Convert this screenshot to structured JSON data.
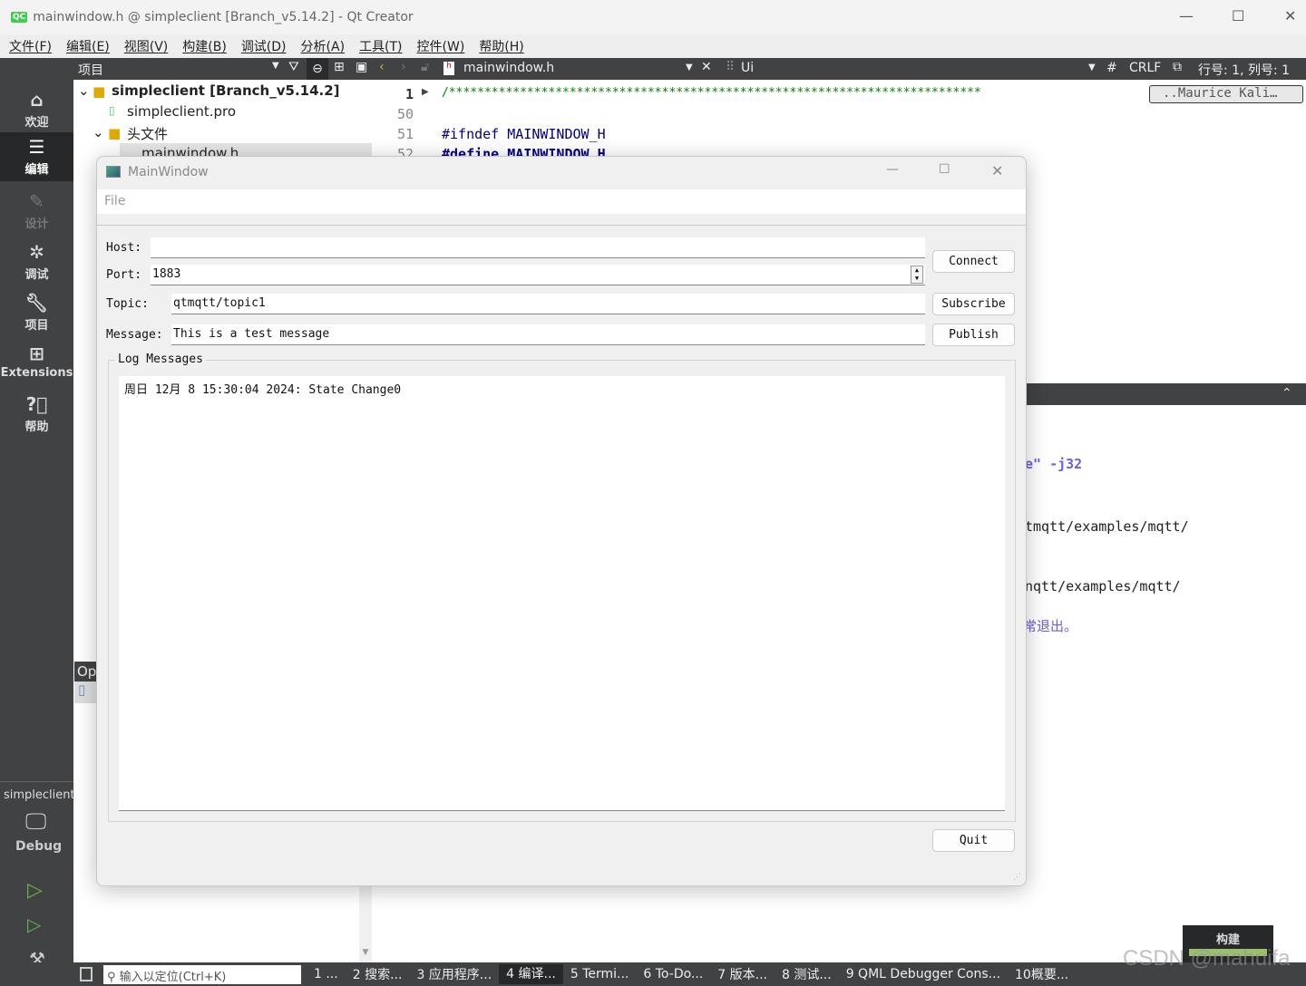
{
  "app": {
    "title": "mainwindow.h @ simpleclient [Branch_v5.14.2] - Qt Creator",
    "logo": "QC"
  },
  "menu": [
    "文件(F)",
    "编辑(E)",
    "视图(V)",
    "构建(B)",
    "调试(D)",
    "分析(A)",
    "工具(T)",
    "控件(W)",
    "帮助(H)"
  ],
  "toolbar": {
    "projects_label": "项目",
    "file_name": "mainwindow.h",
    "symbol": "Ui",
    "hash": "#",
    "line_ending": "CRLF",
    "position": "行号: 1, 列号: 1"
  },
  "modes": [
    {
      "label": "欢迎",
      "icon": "home-icon"
    },
    {
      "label": "编辑",
      "icon": "edit-icon"
    },
    {
      "label": "设计",
      "icon": "design-icon"
    },
    {
      "label": "调试",
      "icon": "bug-icon"
    },
    {
      "label": "项目",
      "icon": "wrench-icon"
    },
    {
      "label": "Extensions",
      "icon": "extensions-icon"
    },
    {
      "label": "帮助",
      "icon": "help-icon"
    }
  ],
  "kit": {
    "project": "simpleclient",
    "build": "Debug"
  },
  "tree": {
    "root": "simpleclient [Branch_v5.14.2]",
    "pro": "simpleclient.pro",
    "headers": "头文件",
    "file": "mainwindow.h",
    "open_docs": "Op"
  },
  "editor": {
    "lines": [
      {
        "n": "1",
        "text": "/***************************************************************************"
      },
      {
        "n": "50",
        "text": ""
      },
      {
        "n": "51",
        "text": "#ifndef MAINWINDOW_H"
      },
      {
        "n": "52",
        "text": "#define MAINWINDOW_H"
      }
    ],
    "fold_label": "..Maurice Kali…",
    "output": [
      "e\" -j32",
      "tmqtt/examples/mqtt/",
      "nqtt/examples/mqtt/",
      "常退出。"
    ]
  },
  "dialog": {
    "title": "MainWindow",
    "menu_file": "File",
    "host_label": "Host:",
    "host_value": "",
    "port_label": "Port:",
    "port_value": "1883",
    "topic_label": "Topic:",
    "topic_value": "qtmqtt/topic1",
    "message_label": "Message:",
    "message_value": "This is a test message",
    "connect": "Connect",
    "subscribe": "Subscribe",
    "publish": "Publish",
    "log_title": "Log Messages",
    "log_lines": [
      "周日 12月 8 15:30:04 2024: State Change0"
    ],
    "quit": "Quit"
  },
  "status": {
    "locator_placeholder": "输入以定位(Ctrl+K)",
    "panes": [
      "1 ...",
      "2 搜索...",
      "3 应用程序...",
      "4 编译...",
      "5 Termi...",
      "6 To-Do...",
      "7 版本...",
      "8 测试...",
      "9 QML Debugger Cons...",
      "10概要..."
    ],
    "build_popup": "构建",
    "build_progress": 1.0
  },
  "watermark": "CSDN @mahuifa"
}
